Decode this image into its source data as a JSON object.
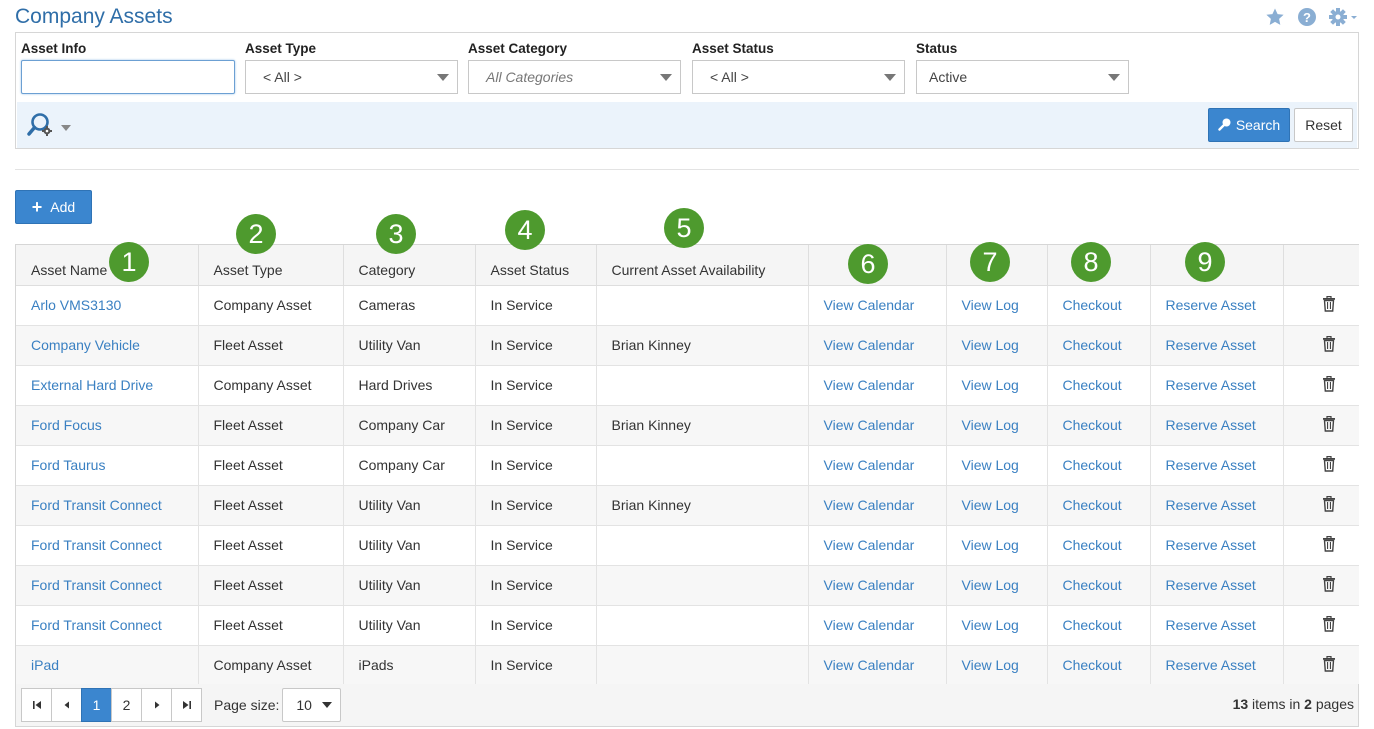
{
  "page": {
    "title": "Company Assets"
  },
  "top_icons": [
    "star-icon",
    "help-icon",
    "gear-icon"
  ],
  "filters": {
    "asset_info": {
      "label": "Asset Info",
      "value": ""
    },
    "asset_type": {
      "label": "Asset Type",
      "value": "< All >"
    },
    "asset_category": {
      "label": "Asset Category",
      "value": "All Categories"
    },
    "asset_status": {
      "label": "Asset Status",
      "value": "< All >"
    },
    "status": {
      "label": "Status",
      "value": "Active"
    }
  },
  "buttons": {
    "search": "Search",
    "reset": "Reset",
    "add": "Add"
  },
  "table": {
    "headers": [
      "Asset Name",
      "Asset Type",
      "Category",
      "Asset Status",
      "Current Asset Availability",
      "",
      "",
      "",
      "",
      ""
    ],
    "rows": [
      {
        "name": "Arlo VMS3130",
        "type": "Company Asset",
        "category": "Cameras",
        "status": "In Service",
        "availability": "",
        "calendar": "View Calendar",
        "log": "View Log",
        "checkout": "Checkout",
        "reserve": "Reserve Asset"
      },
      {
        "name": "Company Vehicle",
        "type": "Fleet Asset",
        "category": "Utility Van",
        "status": "In Service",
        "availability": "Brian Kinney",
        "calendar": "View Calendar",
        "log": "View Log",
        "checkout": "Checkout",
        "reserve": "Reserve Asset"
      },
      {
        "name": "External Hard Drive",
        "type": "Company Asset",
        "category": "Hard Drives",
        "status": "In Service",
        "availability": "",
        "calendar": "View Calendar",
        "log": "View Log",
        "checkout": "Checkout",
        "reserve": "Reserve Asset"
      },
      {
        "name": "Ford Focus",
        "type": "Fleet Asset",
        "category": "Company Car",
        "status": "In Service",
        "availability": "Brian Kinney",
        "calendar": "View Calendar",
        "log": "View Log",
        "checkout": "Checkout",
        "reserve": "Reserve Asset"
      },
      {
        "name": "Ford Taurus",
        "type": "Fleet Asset",
        "category": "Company Car",
        "status": "In Service",
        "availability": "",
        "calendar": "View Calendar",
        "log": "View Log",
        "checkout": "Checkout",
        "reserve": "Reserve Asset"
      },
      {
        "name": "Ford Transit Connect",
        "type": "Fleet Asset",
        "category": "Utility Van",
        "status": "In Service",
        "availability": "Brian Kinney",
        "calendar": "View Calendar",
        "log": "View Log",
        "checkout": "Checkout",
        "reserve": "Reserve Asset"
      },
      {
        "name": "Ford Transit Connect",
        "type": "Fleet Asset",
        "category": "Utility Van",
        "status": "In Service",
        "availability": "",
        "calendar": "View Calendar",
        "log": "View Log",
        "checkout": "Checkout",
        "reserve": "Reserve Asset"
      },
      {
        "name": "Ford Transit Connect",
        "type": "Fleet Asset",
        "category": "Utility Van",
        "status": "In Service",
        "availability": "",
        "calendar": "View Calendar",
        "log": "View Log",
        "checkout": "Checkout",
        "reserve": "Reserve Asset"
      },
      {
        "name": "Ford Transit Connect",
        "type": "Fleet Asset",
        "category": "Utility Van",
        "status": "In Service",
        "availability": "",
        "calendar": "View Calendar",
        "log": "View Log",
        "checkout": "Checkout",
        "reserve": "Reserve Asset"
      },
      {
        "name": "iPad",
        "type": "Company Asset",
        "category": "iPads",
        "status": "In Service",
        "availability": "",
        "calendar": "View Calendar",
        "log": "View Log",
        "checkout": "Checkout",
        "reserve": "Reserve Asset"
      }
    ]
  },
  "annotations": [
    "1",
    "2",
    "3",
    "4",
    "5",
    "6",
    "7",
    "8",
    "9"
  ],
  "pager": {
    "pages": [
      "1",
      "2"
    ],
    "current_page": "1",
    "page_size_label": "Page size:",
    "page_size": "10",
    "info_items": "13",
    "info_items_text": " items in ",
    "info_pages": "2",
    "info_pages_text": " pages"
  },
  "colors": {
    "accent": "#3b86cf",
    "link": "#3a80c2",
    "badge": "#4e9a2e",
    "title": "#2f6ea8"
  }
}
